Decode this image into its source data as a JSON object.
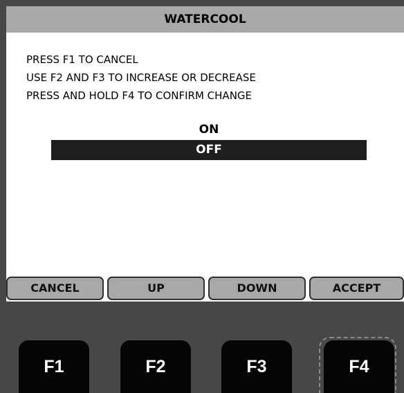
{
  "screen": {
    "title": "WATERCOOL",
    "instructions": [
      "PRESS F1 TO CANCEL",
      "USE F2 AND F3 TO INCREASE OR DECREASE",
      "PRESS AND HOLD F4 TO CONFIRM CHANGE"
    ],
    "options": [
      {
        "label": "ON",
        "selected": false
      },
      {
        "label": "OFF",
        "selected": true
      }
    ]
  },
  "softkeys": [
    {
      "label": "CANCEL"
    },
    {
      "label": "UP"
    },
    {
      "label": "DOWN"
    },
    {
      "label": "ACCEPT"
    }
  ],
  "function_keys": [
    {
      "label": "F1"
    },
    {
      "label": "F2"
    },
    {
      "label": "F3"
    },
    {
      "label": "F4",
      "focused": true
    }
  ],
  "colors": {
    "bezel": "#474747",
    "title_bar": "#a8a8a8",
    "selected_row": "#1e1e1e",
    "key": "#050505"
  }
}
